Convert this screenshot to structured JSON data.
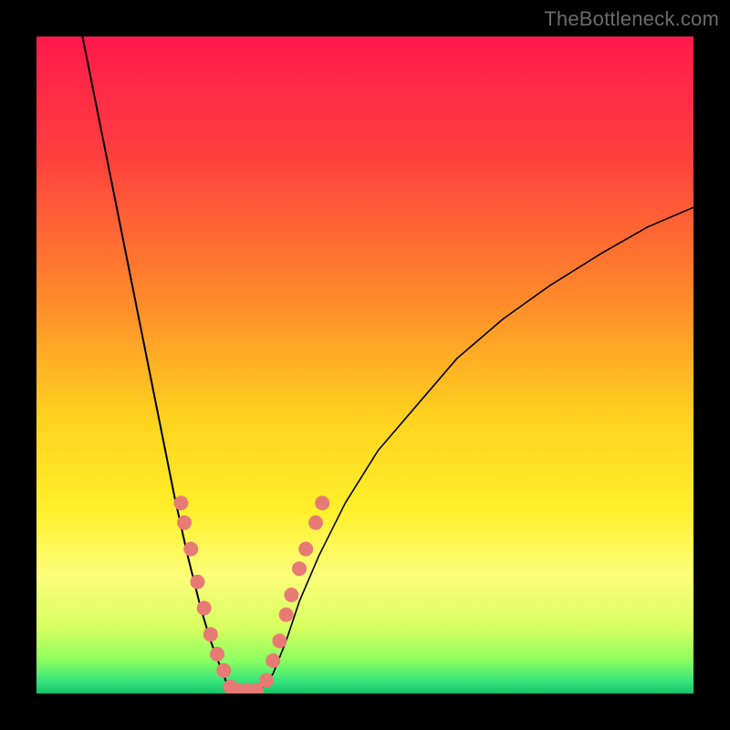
{
  "watermark": "TheBottleneck.com",
  "chart_data": {
    "type": "line",
    "title": "",
    "xlabel": "",
    "ylabel": "",
    "xlim": [
      0,
      100
    ],
    "ylim": [
      0,
      100
    ],
    "background_gradient": {
      "stops": [
        {
          "offset": 0.0,
          "color": "#ff1a4b"
        },
        {
          "offset": 0.18,
          "color": "#ff3f3f"
        },
        {
          "offset": 0.4,
          "color": "#ff8a2a"
        },
        {
          "offset": 0.58,
          "color": "#ffd21f"
        },
        {
          "offset": 0.72,
          "color": "#fff02a"
        },
        {
          "offset": 0.82,
          "color": "#fdfe7a"
        },
        {
          "offset": 0.9,
          "color": "#d7ff60"
        },
        {
          "offset": 0.95,
          "color": "#8cff60"
        },
        {
          "offset": 0.98,
          "color": "#39e57a"
        },
        {
          "offset": 1.0,
          "color": "#18c36b"
        }
      ]
    },
    "series": [
      {
        "name": "left-branch",
        "color": "#000000",
        "width": 2.0,
        "x": [
          7.0,
          9.0,
          11.0,
          13.0,
          15.0,
          17.0,
          19.0,
          21.0,
          23.0,
          25.0,
          26.5,
          28.0,
          29.0,
          30.0
        ],
        "y": [
          100.0,
          90.0,
          80.0,
          70.0,
          60.0,
          50.0,
          40.0,
          30.0,
          21.0,
          13.0,
          8.0,
          4.0,
          1.5,
          0.3
        ]
      },
      {
        "name": "right-branch",
        "color": "#000000",
        "width": 1.6,
        "x": [
          34.0,
          36.0,
          38.0,
          40.0,
          43.0,
          47.0,
          52.0,
          58.0,
          64.0,
          71.0,
          78.0,
          86.0,
          93.0,
          100.0
        ],
        "y": [
          0.3,
          3.0,
          8.0,
          14.0,
          21.0,
          29.0,
          37.0,
          44.0,
          51.0,
          57.0,
          62.0,
          67.0,
          71.0,
          74.0
        ]
      },
      {
        "name": "valley-floor",
        "color": "#000000",
        "width": 2.0,
        "x": [
          30.0,
          31.0,
          32.0,
          33.0,
          34.0
        ],
        "y": [
          0.3,
          0.1,
          0.1,
          0.1,
          0.3
        ]
      }
    ],
    "markers": {
      "name": "highlight-dots",
      "color": "#e77a75",
      "radius": 8,
      "points": [
        {
          "x": 22.0,
          "y": 29.0
        },
        {
          "x": 22.5,
          "y": 26.0
        },
        {
          "x": 23.5,
          "y": 22.0
        },
        {
          "x": 24.5,
          "y": 17.0
        },
        {
          "x": 25.5,
          "y": 13.0
        },
        {
          "x": 26.5,
          "y": 9.0
        },
        {
          "x": 27.5,
          "y": 6.0
        },
        {
          "x": 28.5,
          "y": 3.5
        },
        {
          "x": 29.5,
          "y": 1.0
        },
        {
          "x": 30.5,
          "y": 0.5
        },
        {
          "x": 32.0,
          "y": 0.5
        },
        {
          "x": 33.5,
          "y": 0.5
        },
        {
          "x": 35.0,
          "y": 2.0
        },
        {
          "x": 36.0,
          "y": 5.0
        },
        {
          "x": 37.0,
          "y": 8.0
        },
        {
          "x": 38.0,
          "y": 12.0
        },
        {
          "x": 38.8,
          "y": 15.0
        },
        {
          "x": 40.0,
          "y": 19.0
        },
        {
          "x": 41.0,
          "y": 22.0
        },
        {
          "x": 42.5,
          "y": 26.0
        },
        {
          "x": 43.5,
          "y": 29.0
        }
      ]
    }
  }
}
